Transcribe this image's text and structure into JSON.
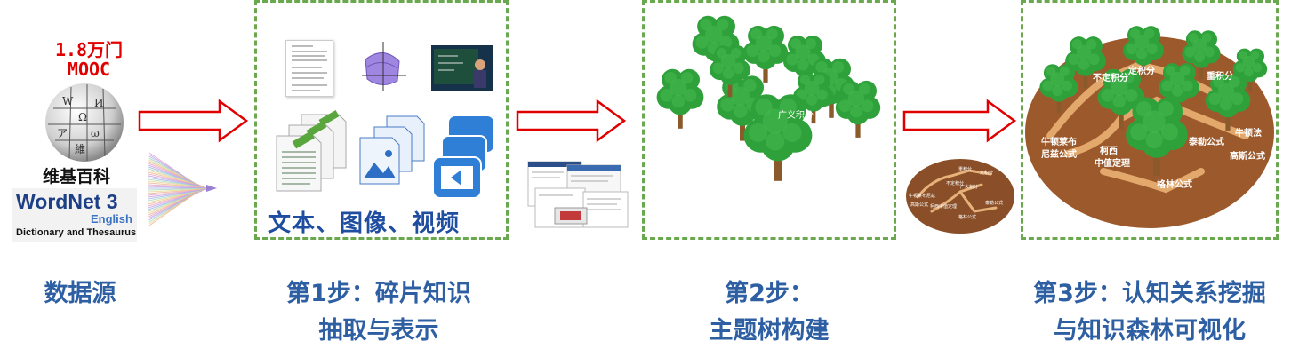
{
  "source": {
    "mooc_count": "1.8万门",
    "mooc_label": "MOOC",
    "wikipedia_label": "维基百科",
    "wordnet_title": "WordNet 3",
    "wordnet_sub": "English",
    "wordnet_tagline": "Dictionary and Thesaurus",
    "caption": "数据源"
  },
  "step1": {
    "media_label": "文本、图像、视频",
    "caption_line1": "第1步：碎片知识",
    "caption_line2": "抽取与表示"
  },
  "step2": {
    "tree_label": "广义积分",
    "caption_line1": "第2步：",
    "caption_line2": "主题树构建"
  },
  "step3": {
    "caption_line1": "第3步：认知关系挖掘",
    "caption_line2": "与知识森林可视化",
    "forest_labels": [
      "定积分",
      "不定积分",
      "重积分",
      "牛顿莱布",
      "尼兹公式",
      "柯西",
      "中值定理",
      "泰勒公式",
      "牛顿法",
      "高斯公式",
      "格林公式"
    ],
    "mini_labels": [
      "重积分",
      "定积分",
      "不定积分",
      "广义积分",
      "牛顿莱布尼兹",
      "柯西中值定理",
      "高斯公式",
      "泰勒公式",
      "格林公式"
    ]
  },
  "colors": {
    "caption": "#2e5fa3",
    "panel_border": "#6aa84f",
    "arrow": "#e00000",
    "ground": "#9c5a2c",
    "tree": "#2fa13b"
  }
}
